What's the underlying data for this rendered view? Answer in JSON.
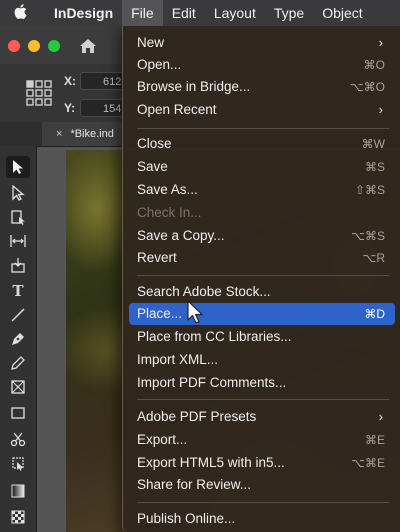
{
  "menubar": {
    "apple_icon": "apple-icon",
    "app": "InDesign",
    "items": [
      "File",
      "Edit",
      "Layout",
      "Type",
      "Object"
    ],
    "active": "File"
  },
  "control": {
    "x_label": "X:",
    "x_value": "612",
    "y_label": "Y:",
    "y_value": "154"
  },
  "document_tab": {
    "close": "×",
    "title": "*Bike.ind"
  },
  "file_menu": {
    "groups": [
      [
        {
          "label": "New",
          "submenu": true
        },
        {
          "label": "Open...",
          "shortcut": "⌘O"
        },
        {
          "label": "Browse in Bridge...",
          "shortcut": "⌥⌘O"
        },
        {
          "label": "Open Recent",
          "submenu": true
        }
      ],
      [
        {
          "label": "Close",
          "shortcut": "⌘W"
        },
        {
          "label": "Save",
          "shortcut": "⌘S"
        },
        {
          "label": "Save As...",
          "shortcut": "⇧⌘S"
        },
        {
          "label": "Check In...",
          "disabled": true
        },
        {
          "label": "Save a Copy...",
          "shortcut": "⌥⌘S"
        },
        {
          "label": "Revert",
          "shortcut": "⌥R"
        }
      ],
      [
        {
          "label": "Search Adobe Stock..."
        },
        {
          "label": "Place...",
          "shortcut": "⌘D",
          "highlighted": true
        },
        {
          "label": "Place from CC Libraries..."
        },
        {
          "label": "Import XML..."
        },
        {
          "label": "Import PDF Comments..."
        }
      ],
      [
        {
          "label": "Adobe PDF Presets",
          "submenu": true
        },
        {
          "label": "Export...",
          "shortcut": "⌘E"
        },
        {
          "label": "Export HTML5 with in5...",
          "shortcut": "⌥⌘E"
        },
        {
          "label": "Share for Review..."
        }
      ],
      [
        {
          "label": "Publish Online..."
        }
      ]
    ],
    "submenu_glyph": "›"
  },
  "colors": {
    "highlight": "#2f63c9",
    "menu_bg": "#30261e",
    "menubar_bg": "#3a3a3c"
  }
}
